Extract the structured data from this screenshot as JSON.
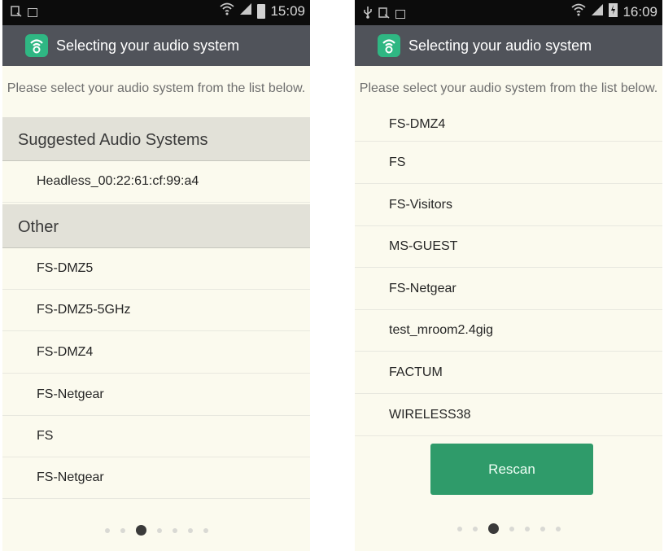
{
  "screens": [
    {
      "status": {
        "time": "15:09"
      },
      "title": "Selecting your audio system",
      "instruction": "Please select your audio system from the list below.",
      "sections": {
        "suggested": {
          "label": "Suggested Audio Systems",
          "items": [
            "Headless_00:22:61:cf:99:a4"
          ]
        },
        "other": {
          "label": "Other",
          "items": [
            "FS-DMZ5",
            "FS-DMZ5-5GHz",
            "FS-DMZ4",
            "FS-Netgear",
            "FS",
            "FS-Netgear"
          ]
        }
      },
      "page_indicator": {
        "total": 7,
        "current": 3
      }
    },
    {
      "status": {
        "time": "16:09"
      },
      "title": "Selecting your audio system",
      "instruction": "Please select your audio system from the list below.",
      "list_items": [
        "FS-DMZ4",
        "FS",
        "FS-Visitors",
        "MS-GUEST",
        "FS-Netgear",
        "test_mroom2.4gig",
        "FACTUM",
        "WIRELESS38"
      ],
      "rescan_label": "Rescan",
      "page_indicator": {
        "total": 7,
        "current": 3
      }
    }
  ],
  "colors": {
    "status_bar": "#0c0c0c",
    "action_bar": "#50535a",
    "app_icon": "#2fb783",
    "background": "#fbfaee",
    "section_header": "#e2e1d8",
    "rescan_button": "#2f9b6a"
  },
  "icons": {
    "app": "wifi-signal-icon",
    "status_left_1": "notification-icon",
    "status_left_2": "image-icon",
    "status_usb": "usb-icon",
    "status_wifi": "wifi-icon",
    "status_signal": "signal-icon",
    "status_battery": "battery-icon"
  }
}
